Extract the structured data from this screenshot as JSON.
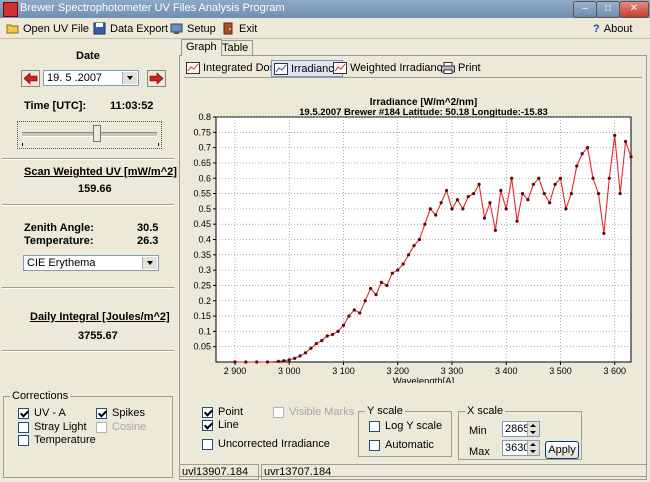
{
  "window": {
    "title": "Brewer Spectrophotometer UV Files Analysis Program"
  },
  "menu": {
    "open": "Open UV File",
    "export": "Data Export",
    "setup": "Setup",
    "exit": "Exit",
    "about": "About"
  },
  "left": {
    "date_label": "Date",
    "date_value": "19. 5 .2007",
    "time_label": "Time [UTC]:",
    "time_value": "11:03:52",
    "scan_label": "Scan Weighted UV [mW/m^2]",
    "scan_value": "159.66",
    "zenith_label": "Zenith Angle:",
    "zenith_value": "30.5",
    "temp_label": "Temperature:",
    "temp_value": "26.3",
    "weighting": "CIE Erythema",
    "daily_label": "Daily Integral [Joules/m^2]",
    "daily_value": "3755.67"
  },
  "corrections": {
    "title": "Corrections",
    "uva": "UV - A",
    "stray": "Stray Light",
    "temperature": "Temperature",
    "spikes": "Spikes",
    "cosine": "Cosine"
  },
  "tabs": {
    "graph": "Graph",
    "table": "Table"
  },
  "subtabs": {
    "integrated": "Integrated Dose",
    "irradiance": "Irradiance",
    "weighted": "Weighted Irradiance",
    "print": "Print"
  },
  "controls": {
    "point": "Point",
    "line": "Line",
    "visible_marks": "Visible Marks",
    "uncorrected": "Uncorrected Irradiance",
    "yscale_title": "Y scale",
    "log_y": "Log Y scale",
    "automatic": "Automatic",
    "xscale_title": "X scale",
    "min_label": "Min",
    "min_value": "2865",
    "max_label": "Max",
    "max_value": "3630",
    "apply": "Apply"
  },
  "status": {
    "file1": "uvl13907.184",
    "file2": "uvr13707.184"
  },
  "colors": {
    "series": "#e8262b",
    "marker": "#5a0a0a",
    "plot_bg": "#ffffff",
    "panel_bg": "#ece9d8"
  },
  "chart_data": {
    "type": "line",
    "title": "Irradiance [W/m^2/nm]",
    "subtitle": "19.5.2007   Brewer #184   Latitude: 50.18   Longitude:-15.83",
    "xlabel": "Wavelength[A]",
    "ylabel": "",
    "xlim": [
      2865,
      3630
    ],
    "ylim": [
      0,
      0.8
    ],
    "xticks": [
      2900,
      3000,
      3100,
      3200,
      3300,
      3400,
      3500,
      3600
    ],
    "xtick_labels": [
      "2 900",
      "3 000",
      "3 100",
      "3 200",
      "3 300",
      "3 400",
      "3 500",
      "3 600"
    ],
    "yticks": [
      0.05,
      0.1,
      0.15,
      0.2,
      0.25,
      0.3,
      0.35,
      0.4,
      0.45,
      0.5,
      0.55,
      0.6,
      0.65,
      0.7,
      0.75,
      0.8
    ],
    "ytick_labels": [
      "0.05",
      "0.1",
      "0.15",
      "0.2",
      "0.25",
      "0.3",
      "0.35",
      "0.4",
      "0.45",
      "0.5",
      "0.55",
      "0.6",
      "0.65",
      "0.7",
      "0.75",
      "0.8"
    ],
    "grid": true,
    "series": [
      {
        "x": [
          2900,
          2920,
          2940,
          2960,
          2980,
          2990,
          3000,
          3010,
          3020,
          3030,
          3040,
          3050,
          3060,
          3070,
          3080,
          3090,
          3100,
          3110,
          3120,
          3130,
          3140,
          3150,
          3160,
          3170,
          3180,
          3190,
          3200,
          3210,
          3220,
          3230,
          3240,
          3250,
          3260,
          3270,
          3280,
          3290,
          3300,
          3310,
          3320,
          3330,
          3340,
          3350,
          3360,
          3370,
          3380,
          3390,
          3400,
          3410,
          3420,
          3430,
          3440,
          3450,
          3460,
          3470,
          3480,
          3490,
          3500,
          3510,
          3520,
          3530,
          3540,
          3550,
          3560,
          3570,
          3580,
          3590,
          3600,
          3610,
          3620,
          3630
        ],
        "y": [
          0,
          0,
          0,
          0,
          0.002,
          0.004,
          0.007,
          0.012,
          0.02,
          0.03,
          0.045,
          0.06,
          0.07,
          0.085,
          0.09,
          0.1,
          0.12,
          0.15,
          0.17,
          0.16,
          0.2,
          0.24,
          0.22,
          0.26,
          0.25,
          0.29,
          0.3,
          0.32,
          0.35,
          0.38,
          0.4,
          0.45,
          0.5,
          0.48,
          0.52,
          0.56,
          0.5,
          0.53,
          0.5,
          0.54,
          0.55,
          0.58,
          0.47,
          0.52,
          0.43,
          0.56,
          0.5,
          0.6,
          0.46,
          0.55,
          0.53,
          0.58,
          0.6,
          0.55,
          0.52,
          0.58,
          0.6,
          0.5,
          0.55,
          0.64,
          0.68,
          0.7,
          0.6,
          0.55,
          0.42,
          0.6,
          0.74,
          0.55,
          0.72,
          0.67
        ]
      }
    ]
  }
}
